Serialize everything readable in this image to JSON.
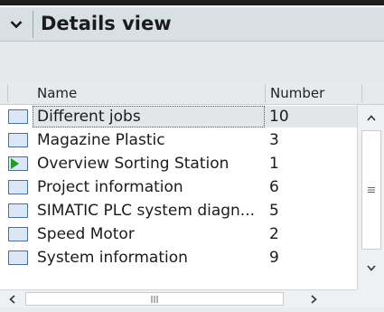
{
  "panel": {
    "title": "Details view"
  },
  "table": {
    "columns": [
      "Name",
      "Number"
    ],
    "rows": [
      {
        "name": "Different jobs",
        "number": "10",
        "icon": "screen-icon",
        "selected": true
      },
      {
        "name": "Magazine Plastic",
        "number": "3",
        "icon": "screen-icon"
      },
      {
        "name": "Overview Sorting Station",
        "number": "1",
        "icon": "start-screen-icon"
      },
      {
        "name": "Project information",
        "number": "6",
        "icon": "screen-icon"
      },
      {
        "name": "SIMATIC PLC system diagn...",
        "number": "5",
        "icon": "screen-icon"
      },
      {
        "name": "Speed Motor",
        "number": "2",
        "icon": "screen-icon"
      },
      {
        "name": "System information",
        "number": "9",
        "icon": "screen-icon"
      }
    ]
  },
  "colors": {
    "header_bg": "#d9e0e4",
    "icon_fill": "#dbe7f7",
    "icon_border": "#4a6fa4",
    "start_arrow": "#1f9a2b"
  }
}
